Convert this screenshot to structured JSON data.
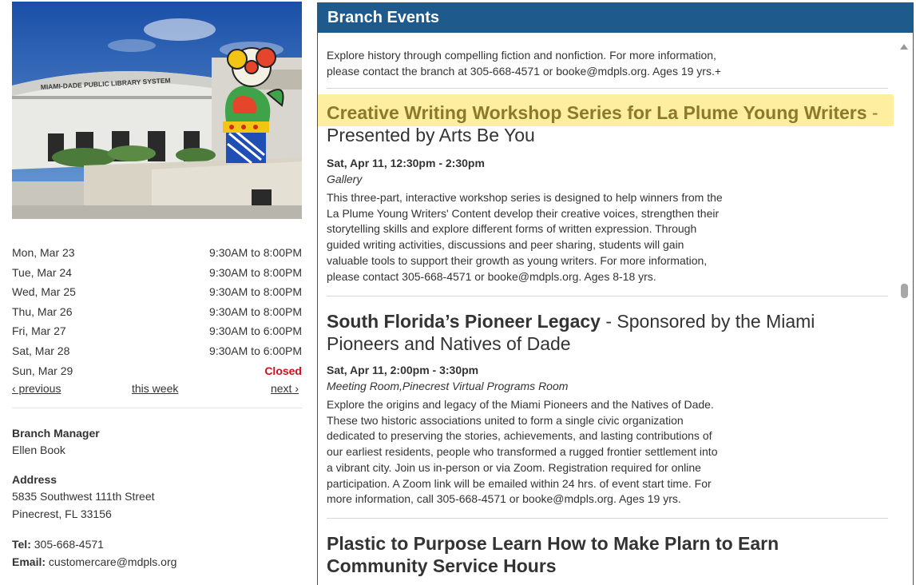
{
  "branch_photo": {
    "sign_text": "MIAMI-DADE PUBLIC LIBRARY SYSTEM",
    "alt": "Pinecrest branch library building with colorful flower sculpture"
  },
  "hours": [
    {
      "day": "Mon, Mar 23",
      "time": "9:30AM to 8:00PM",
      "closed": false
    },
    {
      "day": "Tue, Mar 24",
      "time": "9:30AM to 8:00PM",
      "closed": false
    },
    {
      "day": "Wed, Mar 25",
      "time": "9:30AM to 8:00PM",
      "closed": false
    },
    {
      "day": "Thu, Mar 26",
      "time": "9:30AM to 8:00PM",
      "closed": false
    },
    {
      "day": "Fri, Mar 27",
      "time": "9:30AM to 6:00PM",
      "closed": false
    },
    {
      "day": "Sat, Mar 28",
      "time": "9:30AM to 6:00PM",
      "closed": false
    },
    {
      "day": "Sun, Mar 29",
      "time": "Closed",
      "closed": true
    }
  ],
  "week_nav": {
    "previous": "‹ previous",
    "this_week": "this week",
    "next": "next ›"
  },
  "info": {
    "manager_label": "Branch Manager",
    "manager_name": "Ellen Book",
    "address_label": "Address",
    "address_line1": "5835 Southwest 111th Street",
    "address_line2": "Pinecrest, FL 33156",
    "tel_label": "Tel:",
    "tel_value": "305-668-4571",
    "email_label": "Email:",
    "email_value": "customercare@mdpls.org"
  },
  "panel": {
    "title": "Branch Events",
    "intro": "Explore history through compelling fiction and nonfiction. For more information, please contact the branch at 305-668-4571 or booke@mdpls.org. Ages 19 yrs.+",
    "events": [
      {
        "name": "Creative Writing Workshop Series for La Plume Young Writers",
        "dash": " -",
        "subtitle": "Presented by Arts Be You",
        "when": "Sat, Apr 11, 12:30pm - 2:30pm",
        "where": "Gallery",
        "description": "This three-part, interactive workshop series is designed to help winners from the La Plume Young Writers' Content develop their creative voices, strengthen their storytelling skills and explore different forms of written expression. Through guided writing activities, discussions and peer sharing, students will gain valuable tools to support their growth as young writers. For more information, please contact 305-668-4571 or booke@mdpls.org. Ages 8-18 yrs."
      },
      {
        "name": "South Florida’s Pioneer Legacy",
        "dash": " - ",
        "subtitle": "Sponsored by the Miami Pioneers and Natives of Dade",
        "when": "Sat, Apr 11, 2:00pm - 3:30pm",
        "where": "Meeting Room,Pinecrest Virtual Programs Room",
        "description": "Explore the origins and legacy of the Miami Pioneers and the Natives of Dade. These two historic associations united to form a single civic organization dedicated to preserving the stories, achievements, and lasting contributions of our earliest residents, people who transformed a rugged frontier settlement into a vibrant city. Join us in-person or via Zoom. Registration required for online participation. A Zoom link will be emailed within 24 hrs. of event start time. For more information, call 305-668-4571 or booke@mdpls.org. Ages 19 yrs."
      },
      {
        "name": "Plastic to Purpose Learn How to Make Plarn to Earn Community Service Hours",
        "dash": "",
        "subtitle": ""
      }
    ]
  },
  "colors": {
    "panel_header_bg": "#1e5a8c",
    "closed_red": "#d0101b",
    "highlight_yellow": "#fdeea0"
  }
}
